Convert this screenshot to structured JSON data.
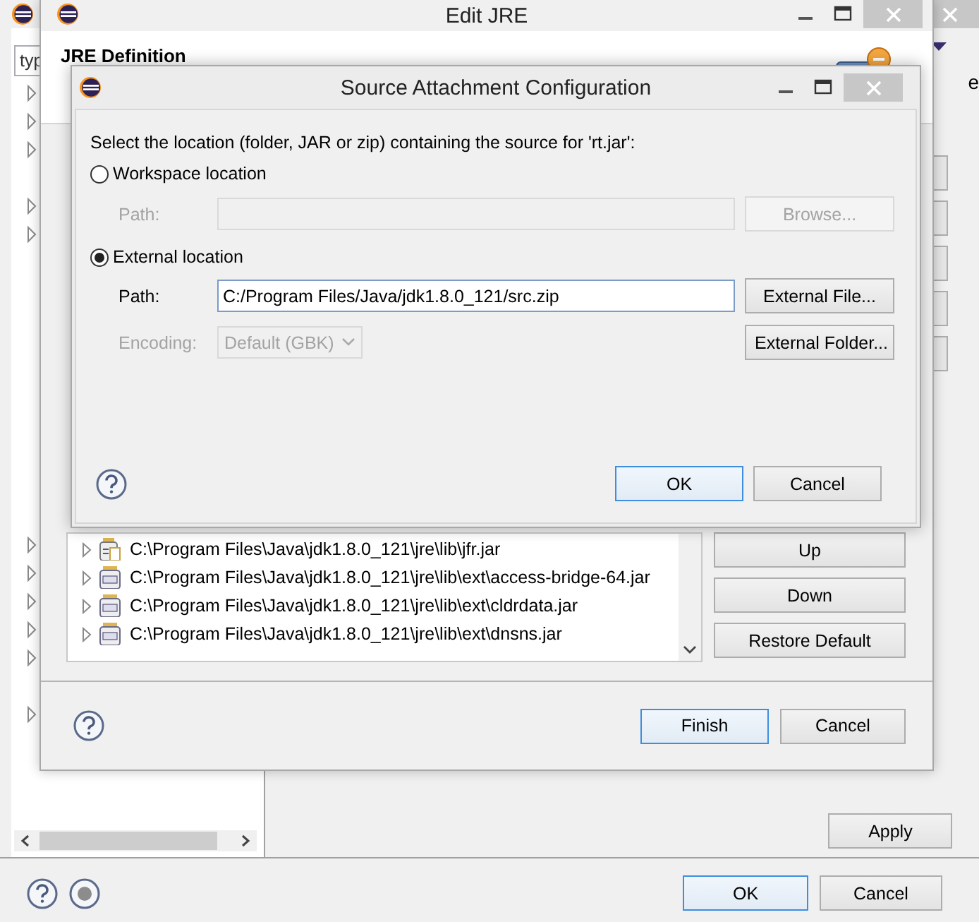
{
  "preferences": {
    "filter": {
      "placeholder": "typ"
    },
    "page_text": "e",
    "apply_button": {
      "label": "Apply",
      "default": false
    },
    "buttons": [
      {
        "label": "OK",
        "default": true
      },
      {
        "label": "Cancel",
        "default": false
      }
    ]
  },
  "edit_jre": {
    "title": "Edit JRE",
    "header": "JRE Definition",
    "libraries": [
      {
        "path": "C:\\Program Files\\Java\\jdk1.8.0_121\\jre\\lib\\jfr.jar",
        "kind": "attached"
      },
      {
        "path": "C:\\Program Files\\Java\\jdk1.8.0_121\\jre\\lib\\ext\\access-bridge-64.jar",
        "kind": "jar"
      },
      {
        "path": "C:\\Program Files\\Java\\jdk1.8.0_121\\jre\\lib\\ext\\cldrdata.jar",
        "kind": "jar"
      },
      {
        "path": "C:\\Program Files\\Java\\jdk1.8.0_121\\jre\\lib\\ext\\dnsns.jar",
        "kind": "jar"
      }
    ],
    "side_buttons": [
      "Up",
      "Down",
      "Restore Default"
    ],
    "buttons": [
      {
        "label": "Finish",
        "default": true
      },
      {
        "label": "Cancel",
        "default": false
      }
    ]
  },
  "source_dialog": {
    "title": "Source Attachment Configuration",
    "prompt": "Select the location (folder, JAR or zip) containing the source for 'rt.jar':",
    "options": [
      {
        "label": "Workspace location",
        "selected": false
      },
      {
        "label": "External location",
        "selected": true
      }
    ],
    "workspace_path": {
      "label": "Path:",
      "disabled": true
    },
    "browse_button": {
      "label": "Browse...",
      "disabled": true
    },
    "external_path": {
      "label": "Path:",
      "value": "C:/Program Files/Java/jdk1.8.0_121/src.zip",
      "disabled": false
    },
    "external_file_button": {
      "label": "External File...",
      "disabled": false
    },
    "encoding": {
      "label": "Encoding:",
      "value": "Default (GBK)",
      "disabled": true
    },
    "external_folder_button": {
      "label": "External Folder...",
      "disabled": false
    },
    "buttons": [
      {
        "label": "OK",
        "default": true
      },
      {
        "label": "Cancel",
        "default": false
      }
    ]
  }
}
